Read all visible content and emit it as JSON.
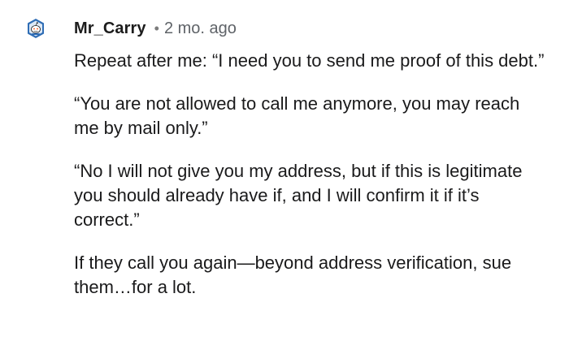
{
  "comment": {
    "username": "Mr_Carry",
    "separator": "•",
    "timestamp": "2 mo. ago",
    "avatar_icon": "snoo-avatar-icon",
    "paragraphs": [
      "Repeat after me: “I need you to send me proof of this debt.”",
      "“You are not allowed to call me anymore, you may reach me by mail only.”",
      "“No I will not give you my address, but if this is legitimate you should already have if, and I will confirm it if it’s correct.”",
      "If they call you again—beyond address verification, sue them…for a lot."
    ]
  },
  "colors": {
    "text": "#1a1a1b",
    "meta": "#5f6368",
    "avatar_blue": "#2f6db5",
    "avatar_accent": "#ff4500"
  }
}
